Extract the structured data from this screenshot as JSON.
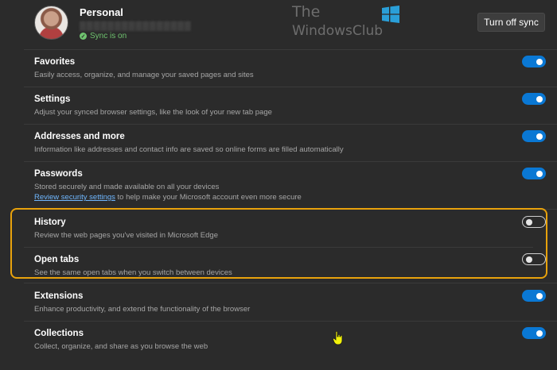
{
  "profile": {
    "name": "Personal",
    "email": "",
    "sync_status": "Sync is on"
  },
  "watermark": {
    "line1": "The",
    "line2": "WindowsClub"
  },
  "turn_off_button": {
    "label": "Turn off sync"
  },
  "settings": [
    {
      "title": "Favorites",
      "desc": "Easily access, organize, and manage your saved pages and sites",
      "enabled": true
    },
    {
      "title": "Settings",
      "desc": "Adjust your synced browser settings, like the look of your new tab page",
      "enabled": true
    },
    {
      "title": "Addresses and more",
      "desc": "Information like addresses and contact info are saved so online forms are filled automatically",
      "enabled": true
    },
    {
      "title": "Passwords",
      "desc": "Stored securely and made available on all your devices",
      "link": "Review security settings",
      "link_suffix": " to help make your Microsoft account even more secure",
      "enabled": true
    },
    {
      "title": "History",
      "desc": "Review the web pages you've visited in Microsoft Edge",
      "enabled": false
    },
    {
      "title": "Open tabs",
      "desc": "See the same open tabs when you switch between devices",
      "enabled": false
    },
    {
      "title": "Extensions",
      "desc": "Enhance productivity, and extend the functionality of the browser",
      "enabled": true
    },
    {
      "title": "Collections",
      "desc": "Collect, organize, and share as you browse the web",
      "enabled": true
    }
  ],
  "colors": {
    "toggle_on": "#0a78d4",
    "highlight": "#e8a20c",
    "sync_green": "#6fc36f",
    "link": "#6fb7ff"
  },
  "icons": {
    "avatar": "avatar",
    "sync": "check-circle-icon",
    "windows_logo": "windows-logo-icon",
    "cursor": "hand-pointer-icon"
  }
}
